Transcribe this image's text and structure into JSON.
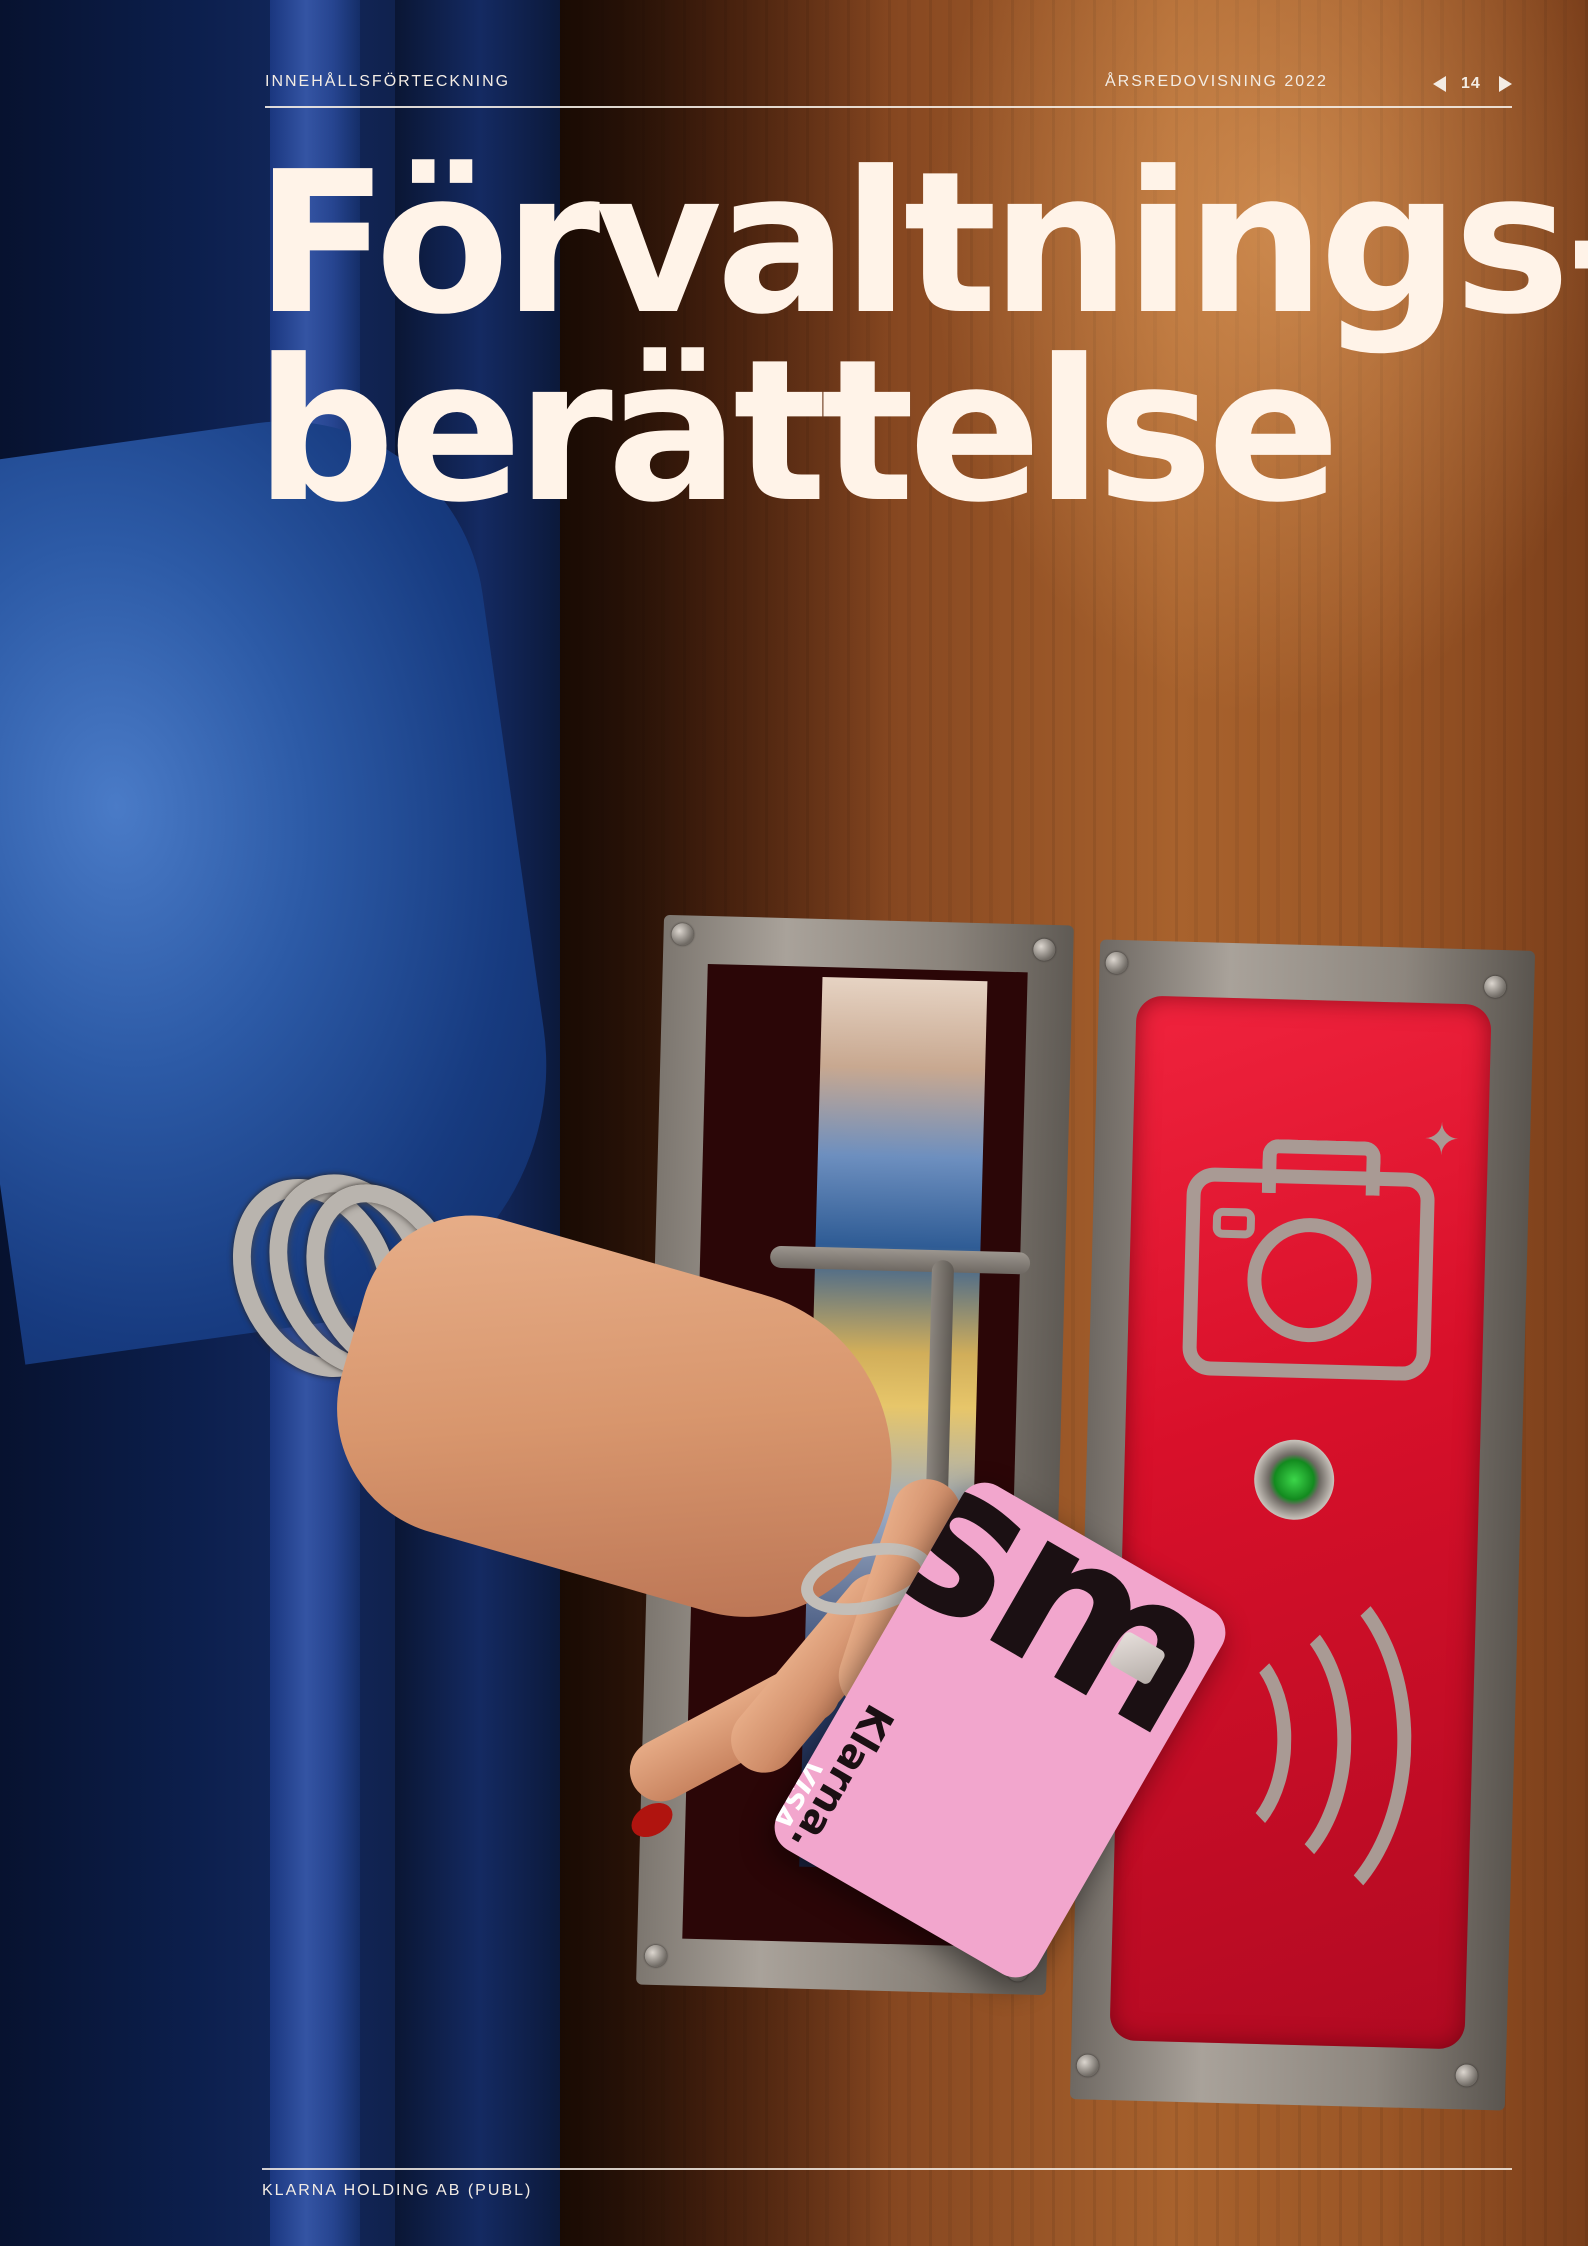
{
  "header": {
    "toc_link": "INNEHÅLLSFÖRTECKNING",
    "document_title": "ÅRSREDOVISNING 2022",
    "page_number": "14",
    "prev_icon": "triangle-left-icon",
    "next_icon": "triangle-right-icon"
  },
  "title": {
    "line1": "Förvaltnings-",
    "line2": "berättelse"
  },
  "photo": {
    "card_brand": "Klarna.",
    "card_network": "VISA",
    "card_text": "smoooth",
    "colors": {
      "wood": "#9b5626",
      "panel_red": "#d8102a",
      "card_pink": "#f2a6cd",
      "curtain_blue": "#13285c"
    }
  },
  "footer": {
    "company": "KLARNA HOLDING AB (PUBL)"
  }
}
